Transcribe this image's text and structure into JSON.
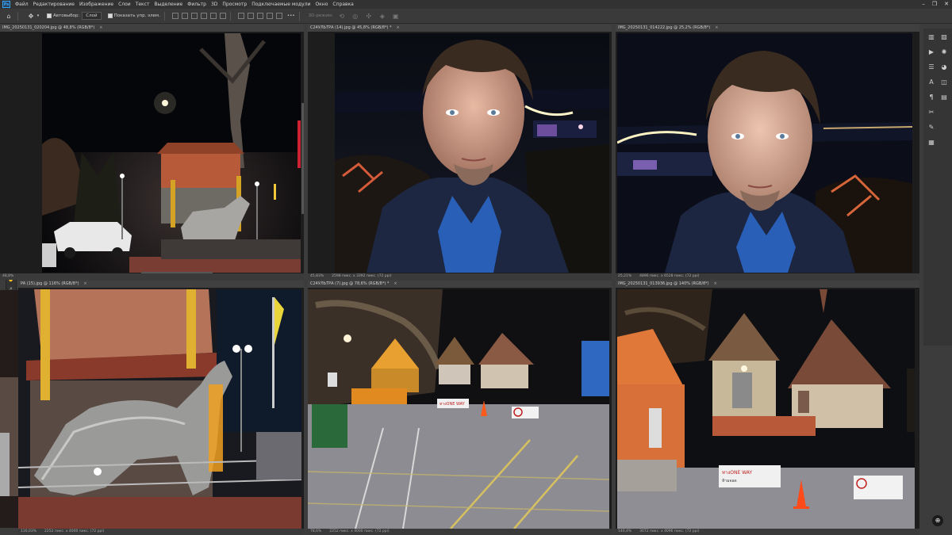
{
  "app": {
    "logo": "Ps",
    "window_controls": {
      "minimize": "–",
      "restore": "❐",
      "close": "✕"
    }
  },
  "menu": [
    "Файл",
    "Редактирование",
    "Изображение",
    "Слои",
    "Текст",
    "Выделение",
    "Фильтр",
    "3D",
    "Просмотр",
    "Подключаемые модули",
    "Окно",
    "Справка"
  ],
  "options": {
    "autoselect_label": "Автовыбор:",
    "autoselect_value": "Слой",
    "show_controls_label": "Показать упр. элем.",
    "more": "•••",
    "mode3d_label": "3D-режим:"
  },
  "documents": [
    {
      "tab": "IMG_20250131_020204.jpg @ 48,8% (RGB/8*)",
      "close": "×",
      "status": "48,8%"
    },
    {
      "tab": "С24УЛЬТРА (14).jpg @ 45,8% (RGB/8*) *",
      "close": "×",
      "status_zoom": "45,83%",
      "status_size": "2598 пикс. x 3392 пикс. (72 ppi)"
    },
    {
      "tab": "IMG_20250131_014222.jpg @ 25,2% (RGB/8*)",
      "close": "×",
      "status_zoom": "25,21%",
      "status_size": "4896 пикс. x 6528 пикс. (72 ppi)"
    },
    {
      "tab": "PA (15).jpg @ 116% (RGB/8*)",
      "close": "×",
      "status_zoom": "116,03%",
      "status_size": "2252 пикс. x 4000 пикс. (72 ppi)"
    },
    {
      "tab": "С24УЛЬТРА (7).jpg @ 78,6% (RGB/8*) *",
      "close": "×",
      "status_zoom": "78,6%",
      "status_size": "2252 пикс. x 4000 пикс. (72 ppi)"
    },
    {
      "tab": "IMG_20250131_013936.jpg @ 140% (RGB/8*)",
      "close": "×",
      "status_zoom": "140,4%",
      "status_size": "3072 пикс. x 4096 пикс. (72 ppi)"
    }
  ],
  "signs": {
    "way": "ทางONE WAY",
    "notice": "ห้ามจอด"
  },
  "colors": {
    "menubar": "#323232",
    "workspace": "#3c3c3c",
    "tab_bg": "#404040",
    "accent": "#31a8ff"
  }
}
